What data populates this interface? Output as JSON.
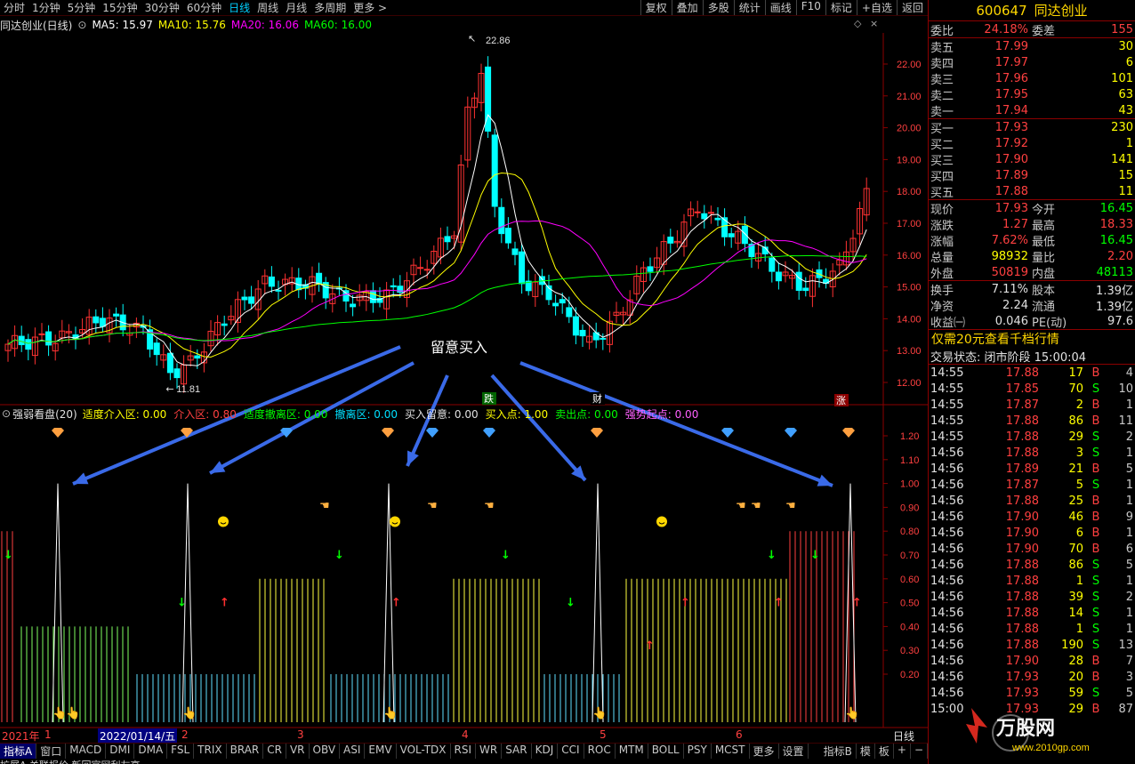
{
  "topbar": {
    "tabs": [
      "分时",
      "1分钟",
      "5分钟",
      "15分钟",
      "30分钟",
      "60分钟",
      "日线",
      "周线",
      "月线",
      "多周期",
      "更多 >"
    ],
    "active_tab": "日线",
    "right_buttons": [
      "复权",
      "叠加",
      "多股",
      "统计",
      "画线",
      "F10",
      "标记",
      "+自选",
      "返回"
    ]
  },
  "title": {
    "name": "同达创业(日线)",
    "ma5": "MA5: 15.97",
    "ma10": "MA10: 15.76",
    "ma20": "MA20: 16.06",
    "ma60": "MA60: 16.00"
  },
  "price_axis": [
    "22.00",
    "21.00",
    "20.00",
    "19.00",
    "18.00",
    "17.00",
    "16.00",
    "15.00",
    "14.00",
    "13.00",
    "12.00"
  ],
  "annotations": {
    "high": "22.86",
    "low": "11.81",
    "overlay_text": "留意买入",
    "die": "跌",
    "cai": "财",
    "zhang": "涨"
  },
  "indicator": {
    "name": "强弱看盘(20)",
    "items": [
      {
        "label": "适度介入区: 0.00",
        "color": "#ffff00"
      },
      {
        "label": "介入区: 0.80",
        "color": "#ff4040"
      },
      {
        "label": "适度撤离区: 0.00",
        "color": "#00ff00"
      },
      {
        "label": "撤离区: 0.00",
        "color": "#00e0ff"
      },
      {
        "label": "买入留意: 0.00",
        "color": "#e0e0e0"
      },
      {
        "label": "买入点: 1.00",
        "color": "#ffff00"
      },
      {
        "label": "卖出点: 0.00",
        "color": "#00ff00"
      },
      {
        "label": "强势起点: 0.00",
        "color": "#ff60ff"
      }
    ],
    "axis": [
      "1.20",
      "1.10",
      "1.00",
      "0.90",
      "0.80",
      "0.70",
      "0.60",
      "0.50",
      "0.40",
      "0.30",
      "0.20"
    ]
  },
  "datebar": {
    "year": "2021年",
    "marks": [
      "1",
      "2",
      "3",
      "4",
      "5",
      "6"
    ],
    "selected_date": "2022/01/14/五",
    "period": "日线"
  },
  "bottom_tabs": [
    "指标A",
    "窗口",
    "MACD",
    "DMI",
    "DMA",
    "FSL",
    "TRIX",
    "BRAR",
    "CR",
    "VR",
    "OBV",
    "ASI",
    "EMV",
    "VOL-TDX",
    "RSI",
    "WR",
    "SAR",
    "KDJ",
    "CCI",
    "ROC",
    "MTM",
    "BOLL",
    "PSY",
    "MCST",
    "更多",
    "设置"
  ],
  "bottom_right": [
    "指标B",
    "模",
    "板",
    "+",
    "−"
  ],
  "bottom_row2": "扩展A  关联报价                                                                                                                                                    新回官网利友高",
  "quote": {
    "code": "600647",
    "name": "同达创业",
    "weibi_label": "委比",
    "weibi": "24.18%",
    "weicha_label": "委差",
    "weicha": "155",
    "asks": [
      {
        "label": "卖五",
        "price": "17.99",
        "vol": "30"
      },
      {
        "label": "卖四",
        "price": "17.97",
        "vol": "6"
      },
      {
        "label": "卖三",
        "price": "17.96",
        "vol": "101"
      },
      {
        "label": "卖二",
        "price": "17.95",
        "vol": "63"
      },
      {
        "label": "卖一",
        "price": "17.94",
        "vol": "43"
      }
    ],
    "bids": [
      {
        "label": "买一",
        "price": "17.93",
        "vol": "230"
      },
      {
        "label": "买二",
        "price": "17.92",
        "vol": "1"
      },
      {
        "label": "买三",
        "price": "17.90",
        "vol": "141"
      },
      {
        "label": "买四",
        "price": "17.89",
        "vol": "15"
      },
      {
        "label": "买五",
        "price": "17.88",
        "vol": "11"
      }
    ],
    "stats": [
      {
        "l1": "现价",
        "v1": "17.93",
        "c1": "red",
        "l2": "今开",
        "v2": "16.45",
        "c2": "green"
      },
      {
        "l1": "涨跌",
        "v1": "1.27",
        "c1": "red",
        "l2": "最高",
        "v2": "18.33",
        "c2": "red"
      },
      {
        "l1": "涨幅",
        "v1": "7.62%",
        "c1": "red",
        "l2": "最低",
        "v2": "16.45",
        "c2": "green"
      },
      {
        "l1": "总量",
        "v1": "98932",
        "c1": "yellow",
        "l2": "量比",
        "v2": "2.20",
        "c2": "red"
      },
      {
        "l1": "外盘",
        "v1": "50819",
        "c1": "red",
        "l2": "内盘",
        "v2": "48113",
        "c2": "green"
      }
    ],
    "stats2": [
      {
        "l1": "换手",
        "v1": "7.11%",
        "l2": "股本",
        "v2": "1.39亿"
      },
      {
        "l1": "净资",
        "v1": "2.24",
        "l2": "流通",
        "v2": "1.39亿"
      },
      {
        "l1": "收益㈠",
        "v1": "0.046",
        "l2": "PE(动)",
        "v2": "97.6"
      }
    ],
    "note": "仅需20元查看千档行情",
    "status": "交易状态: 闭市阶段 15:00:04",
    "ticks": [
      {
        "t": "14:55",
        "p": "17.88",
        "v": "17",
        "d": "B",
        "n": "4"
      },
      {
        "t": "14:55",
        "p": "17.85",
        "v": "70",
        "d": "S",
        "n": "10"
      },
      {
        "t": "14:55",
        "p": "17.87",
        "v": "2",
        "d": "B",
        "n": "1"
      },
      {
        "t": "14:55",
        "p": "17.88",
        "v": "86",
        "d": "B",
        "n": "11"
      },
      {
        "t": "14:55",
        "p": "17.88",
        "v": "29",
        "d": "S",
        "n": "2"
      },
      {
        "t": "14:56",
        "p": "17.88",
        "v": "3",
        "d": "S",
        "n": "1"
      },
      {
        "t": "14:56",
        "p": "17.89",
        "v": "21",
        "d": "B",
        "n": "5"
      },
      {
        "t": "14:56",
        "p": "17.87",
        "v": "5",
        "d": "S",
        "n": "1"
      },
      {
        "t": "14:56",
        "p": "17.88",
        "v": "25",
        "d": "B",
        "n": "1"
      },
      {
        "t": "14:56",
        "p": "17.90",
        "v": "46",
        "d": "B",
        "n": "9"
      },
      {
        "t": "14:56",
        "p": "17.90",
        "v": "6",
        "d": "B",
        "n": "1"
      },
      {
        "t": "14:56",
        "p": "17.90",
        "v": "70",
        "d": "B",
        "n": "6"
      },
      {
        "t": "14:56",
        "p": "17.88",
        "v": "86",
        "d": "S",
        "n": "5"
      },
      {
        "t": "14:56",
        "p": "17.88",
        "v": "1",
        "d": "S",
        "n": "1"
      },
      {
        "t": "14:56",
        "p": "17.88",
        "v": "39",
        "d": "S",
        "n": "2"
      },
      {
        "t": "14:56",
        "p": "17.88",
        "v": "14",
        "d": "S",
        "n": "1"
      },
      {
        "t": "14:56",
        "p": "17.88",
        "v": "1",
        "d": "S",
        "n": "1"
      },
      {
        "t": "14:56",
        "p": "17.88",
        "v": "190",
        "d": "S",
        "n": "13"
      },
      {
        "t": "14:56",
        "p": "17.90",
        "v": "28",
        "d": "B",
        "n": "7"
      },
      {
        "t": "14:56",
        "p": "17.93",
        "v": "20",
        "d": "B",
        "n": "3"
      },
      {
        "t": "14:56",
        "p": "17.93",
        "v": "59",
        "d": "S",
        "n": "5"
      },
      {
        "t": "15:00",
        "p": "17.93",
        "v": "29",
        "d": "B",
        "n": "87"
      }
    ]
  },
  "watermark": {
    "brand": "万股网",
    "url": "www.2010gp.com"
  },
  "colors": {
    "up": "#ff3232",
    "down": "#00ffff",
    "ma5": "#ffffff",
    "ma10": "#ffff00",
    "ma20": "#ff00ff",
    "ma60": "#00ff00",
    "border": "#8b0000"
  }
}
